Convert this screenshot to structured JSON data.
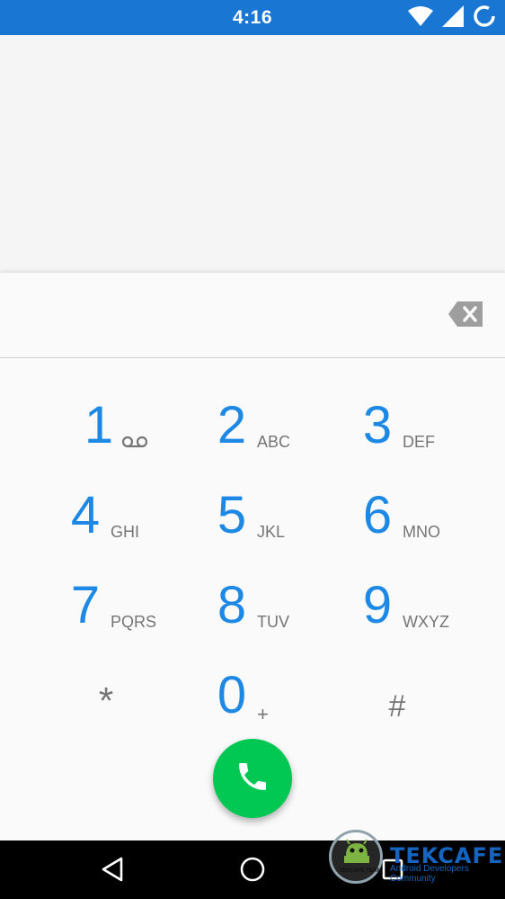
{
  "status_bar": {
    "time": "4:16",
    "icons": [
      "wifi-icon",
      "signal-icon",
      "sync-icon"
    ],
    "color": "#1976d2"
  },
  "dialer": {
    "digits_value": "",
    "accent_color": "#1e88e5",
    "keys": [
      {
        "digit": "1",
        "letters": "",
        "extra_icon": "voicemail-icon"
      },
      {
        "digit": "2",
        "letters": "ABC"
      },
      {
        "digit": "3",
        "letters": "DEF"
      },
      {
        "digit": "4",
        "letters": "GHI"
      },
      {
        "digit": "5",
        "letters": "JKL"
      },
      {
        "digit": "6",
        "letters": "MNO"
      },
      {
        "digit": "7",
        "letters": "PQRS"
      },
      {
        "digit": "8",
        "letters": "TUV"
      },
      {
        "digit": "9",
        "letters": "WXYZ"
      },
      {
        "digit": "*",
        "letters": ""
      },
      {
        "digit": "0",
        "letters": "+"
      },
      {
        "digit": "#",
        "letters": ""
      }
    ],
    "call_button_color": "#00c853",
    "backspace_icon": "backspace-icon",
    "call_icon": "phone-icon"
  },
  "nav_bar": {
    "icons": [
      "back-icon",
      "home-icon",
      "recents-icon"
    ]
  },
  "watermark": {
    "title": "TEKCAFE",
    "subtitle": "Android Developers Community",
    "badge_text": "TEKCAFE TEAM"
  }
}
